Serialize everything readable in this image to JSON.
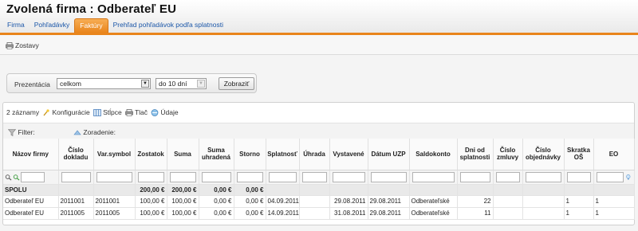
{
  "header": {
    "title": "Zvolená firma :  Odberateľ EU",
    "tabs": [
      {
        "label": "Firma",
        "active": false
      },
      {
        "label": "Pohľadávky",
        "active": false
      },
      {
        "label": "Faktúry",
        "active": true
      },
      {
        "label": "Prehľad pohľadávok podľa splatnosti",
        "active": false
      }
    ]
  },
  "toolbar": {
    "zostavy": "Zostavy"
  },
  "filter": {
    "label": "Prezentácia",
    "presentation_value": "celkom",
    "period_value": "do 10 dní",
    "button": "Zobraziť"
  },
  "grid": {
    "count": "2 záznamy",
    "actions": [
      "Konfigurácie",
      "Stĺpce",
      "Tlač",
      "Údaje"
    ],
    "filter_label": "Filter:",
    "sort_label": "Zoradenie:",
    "columns": [
      "Názov firmy",
      "Číslo dokladu",
      "Var.symbol",
      "Zostatok",
      "Suma",
      "Suma uhradená",
      "Storno",
      "Splatnosť",
      "Úhrada",
      "Vystavené",
      "Dátum UZP",
      "Saldokonto",
      "Dni od splatnosti",
      "Číslo zmluvy",
      "Číslo objednávky",
      "Skratka OŠ",
      "EO"
    ],
    "summary": {
      "label": "SPOLU",
      "zostatok": "200,00 €",
      "suma": "200,00 €",
      "suma_uhradena": "0,00 €",
      "storno": "0,00 €"
    },
    "rows": [
      {
        "nazov": "Odberateľ EU",
        "cislo": "2011001",
        "var": "2011001",
        "zostatok": "100,00 €",
        "suma": "100,00 €",
        "uhradena": "0,00 €",
        "storno": "0,00 €",
        "splatnost": "04.09.2011",
        "uhrada": "",
        "vystavene": "29.08.2011",
        "uzp": "29.08.2011",
        "saldokonto": "Odberateľské",
        "dni": "22",
        "zmluva": "",
        "objednavka": "",
        "skratka": "1",
        "eo": "1"
      },
      {
        "nazov": "Odberateľ EU",
        "cislo": "2011005",
        "var": "2011005",
        "zostatok": "100,00 €",
        "suma": "100,00 €",
        "uhradena": "0,00 €",
        "storno": "0,00 €",
        "splatnost": "14.09.2011",
        "uhrada": "",
        "vystavene": "31.08.2011",
        "uzp": "29.08.2011",
        "saldokonto": "Odberateľské",
        "dni": "11",
        "zmluva": "",
        "objednavka": "",
        "skratka": "1",
        "eo": "1"
      }
    ]
  },
  "icons": [
    "printer-icon",
    "wizard-icon",
    "columns-icon",
    "print-icon",
    "data-icon",
    "filter-icon",
    "sort-icon",
    "search-icon",
    "clear-search-icon",
    "help-bulb-icon",
    "dropdown-arrow-icon"
  ]
}
